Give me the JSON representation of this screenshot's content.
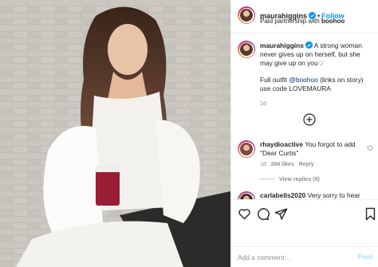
{
  "post": {
    "username": "maurahiggins",
    "verified": true,
    "follow_label": "Follow",
    "sub_prefix": "Paid partnership with",
    "sub_partner": "boohoo",
    "caption_text": "A strong woman never gives up on herself, but she may give up on you♡",
    "caption_line2_prefix": "Full outfit ",
    "caption_mention": "@boohoo",
    "caption_line2_suffix": " (links on story) use code LOVEMAURA",
    "caption_age": "1d"
  },
  "comments": [
    {
      "username": "rhaydioactive",
      "text": "You forgot to add \"Dear Curtis\"",
      "age": "1d",
      "likes": "284 likes",
      "reply_label": "Reply",
      "view_replies": "View replies (9)"
    },
    {
      "username": "carlabells2020",
      "text": "Very sorry to hear"
    }
  ],
  "add_comment": {
    "placeholder": "Add a comment…",
    "post_label": "Post"
  },
  "icons": [
    "verified-badge-icon",
    "load-more-plus-icon",
    "heart-icon",
    "comment-icon",
    "share-icon",
    "bookmark-icon"
  ],
  "colors": {
    "accent": "#0095f6",
    "text": "#262626",
    "muted": "#8e8e8e",
    "border": "#efefef"
  }
}
